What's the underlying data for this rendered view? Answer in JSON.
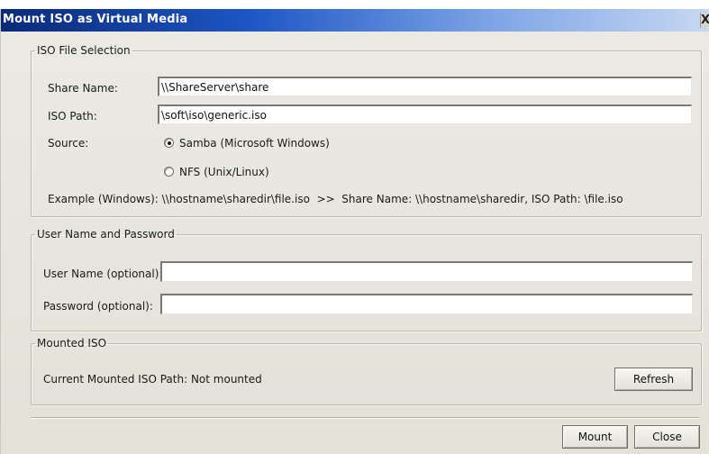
{
  "window": {
    "title": "Mount ISO as Virtual Media",
    "close_glyph": "X"
  },
  "iso_section": {
    "legend": "ISO File Selection",
    "share_name_label": "Share Name:",
    "share_name_value": "\\\\ShareServer\\share",
    "iso_path_label": "ISO Path:",
    "iso_path_value": "\\soft\\iso\\generic.iso",
    "source_label": "Source:",
    "source_options": [
      {
        "label": "Samba (Microsoft Windows)",
        "selected": true
      },
      {
        "label": "NFS (Unix/Linux)",
        "selected": false
      }
    ],
    "example_text": "Example (Windows): \\\\hostname\\sharedir\\file.iso  >>  Share Name: \\\\hostname\\sharedir, ISO Path: \\file.iso"
  },
  "credentials_section": {
    "legend": "User Name and Password",
    "username_label": "User Name (optional):",
    "username_value": "",
    "password_label": "Password (optional):",
    "password_value": ""
  },
  "mounted_section": {
    "legend": "Mounted ISO",
    "status_text": "Current Mounted ISO Path: Not mounted",
    "refresh_label": "Refresh"
  },
  "footer": {
    "mount_label": "Mount",
    "close_label": "Close"
  }
}
